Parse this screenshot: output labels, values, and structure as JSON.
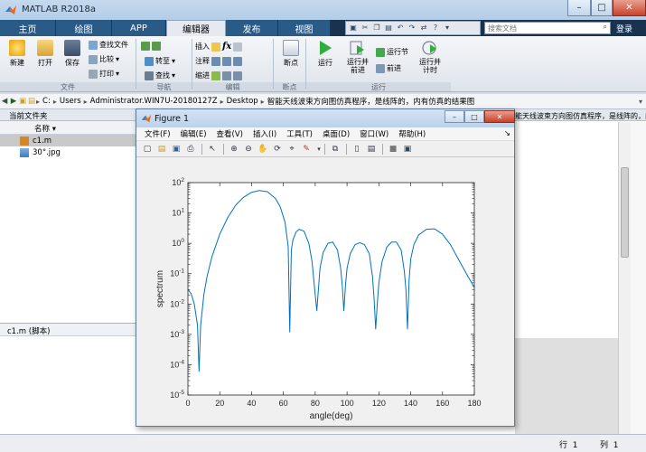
{
  "app": {
    "title": "MATLAB R2018a",
    "search_placeholder": "搜索文档",
    "login": "登录"
  },
  "tabs": [
    "主页",
    "绘图",
    "APP",
    "编辑器",
    "发布",
    "视图"
  ],
  "active_tab": "编辑器",
  "ribbon": {
    "file_buttons": [
      "新建",
      "打开",
      "保存"
    ],
    "file_small": [
      "查找文件",
      "比较",
      "打印"
    ],
    "nav_small": [
      "转至",
      "查找"
    ],
    "edit_small": [
      "插入",
      "注释",
      "缩进"
    ],
    "fx_label": "fx",
    "breakpoint": "断点",
    "run_buttons": [
      "运行",
      "运行并\n前进",
      "运行节",
      "前进",
      "运行并\n计时"
    ],
    "groups": [
      "文件",
      "导航",
      "编辑",
      "断点",
      "运行"
    ]
  },
  "path": {
    "crumbs": [
      "C:",
      "Users",
      "Administrator.WIN7U-20180127Z",
      "Desktop",
      "智能天线波束方向图仿真程序，是线阵的，内有仿真的结果图"
    ]
  },
  "folder_pane": {
    "header": "当前文件夹",
    "column_header": "名称",
    "files": [
      {
        "name": "c1.m",
        "selected": true,
        "icon": "m-file-icon"
      },
      {
        "name": "30°.jpg",
        "selected": false,
        "icon": "image-file-icon"
      }
    ],
    "detail": "c1.m  (脚本)"
  },
  "editor_header": "智能天线波束方向图仿真程序，是线阵的，内有仿真的结果图",
  "status": {
    "row_label": "行",
    "row": "1",
    "col_label": "列",
    "col": "1"
  },
  "figure": {
    "title": "Figure 1",
    "menu": [
      "文件(F)",
      "编辑(E)",
      "查看(V)",
      "插入(I)",
      "工具(T)",
      "桌面(D)",
      "窗口(W)",
      "帮助(H)"
    ]
  },
  "chart_data": {
    "type": "line",
    "title": "",
    "xlabel": "angle(deg)",
    "ylabel": "spectrum",
    "xlim": [
      0,
      180
    ],
    "ylim_log10": [
      -5,
      2
    ],
    "yscale": "log",
    "grid": false,
    "xticks": [
      "0",
      "20",
      "40",
      "60",
      "80",
      "100",
      "120",
      "140",
      "160",
      "180"
    ],
    "yticks": [
      "10^-5",
      "10^-4",
      "10^-3",
      "10^-2",
      "10^-1",
      "10^0",
      "10^1",
      "10^2"
    ],
    "series": [
      {
        "color": "#0072bd",
        "x": [
          0,
          2,
          4,
          6,
          7,
          8,
          10,
          12,
          15,
          20,
          25,
          30,
          35,
          40,
          45,
          50,
          55,
          58,
          61,
          63,
          64,
          65,
          66,
          68,
          70,
          73,
          76,
          78,
          80,
          81,
          82,
          83,
          85,
          88,
          91,
          94,
          96,
          97,
          98,
          99,
          100,
          102,
          105,
          108,
          111,
          114,
          116,
          117,
          118,
          119,
          120,
          122,
          125,
          128,
          131,
          134,
          136,
          137,
          138,
          139,
          140,
          142,
          145,
          150,
          155,
          160,
          165,
          170,
          175,
          180
        ],
        "y": [
          0.03,
          0.022,
          0.01,
          0.002,
          6e-05,
          0.002,
          0.02,
          0.08,
          0.35,
          2.0,
          7.0,
          18,
          33,
          48,
          55,
          50,
          30,
          16,
          5,
          0.8,
          0.0012,
          0.6,
          1.3,
          2.4,
          2.9,
          2.5,
          1.0,
          0.25,
          0.02,
          0.006,
          0.03,
          0.15,
          0.5,
          1.0,
          1.1,
          0.6,
          0.15,
          0.04,
          0.006,
          0.04,
          0.15,
          0.45,
          0.9,
          1.05,
          0.9,
          0.45,
          0.08,
          0.015,
          0.0015,
          0.01,
          0.05,
          0.25,
          0.75,
          1.1,
          1.1,
          0.6,
          0.12,
          0.03,
          0.0015,
          0.06,
          0.3,
          0.9,
          1.9,
          2.9,
          3.0,
          2.0,
          0.9,
          0.3,
          0.1,
          0.035
        ]
      }
    ]
  }
}
